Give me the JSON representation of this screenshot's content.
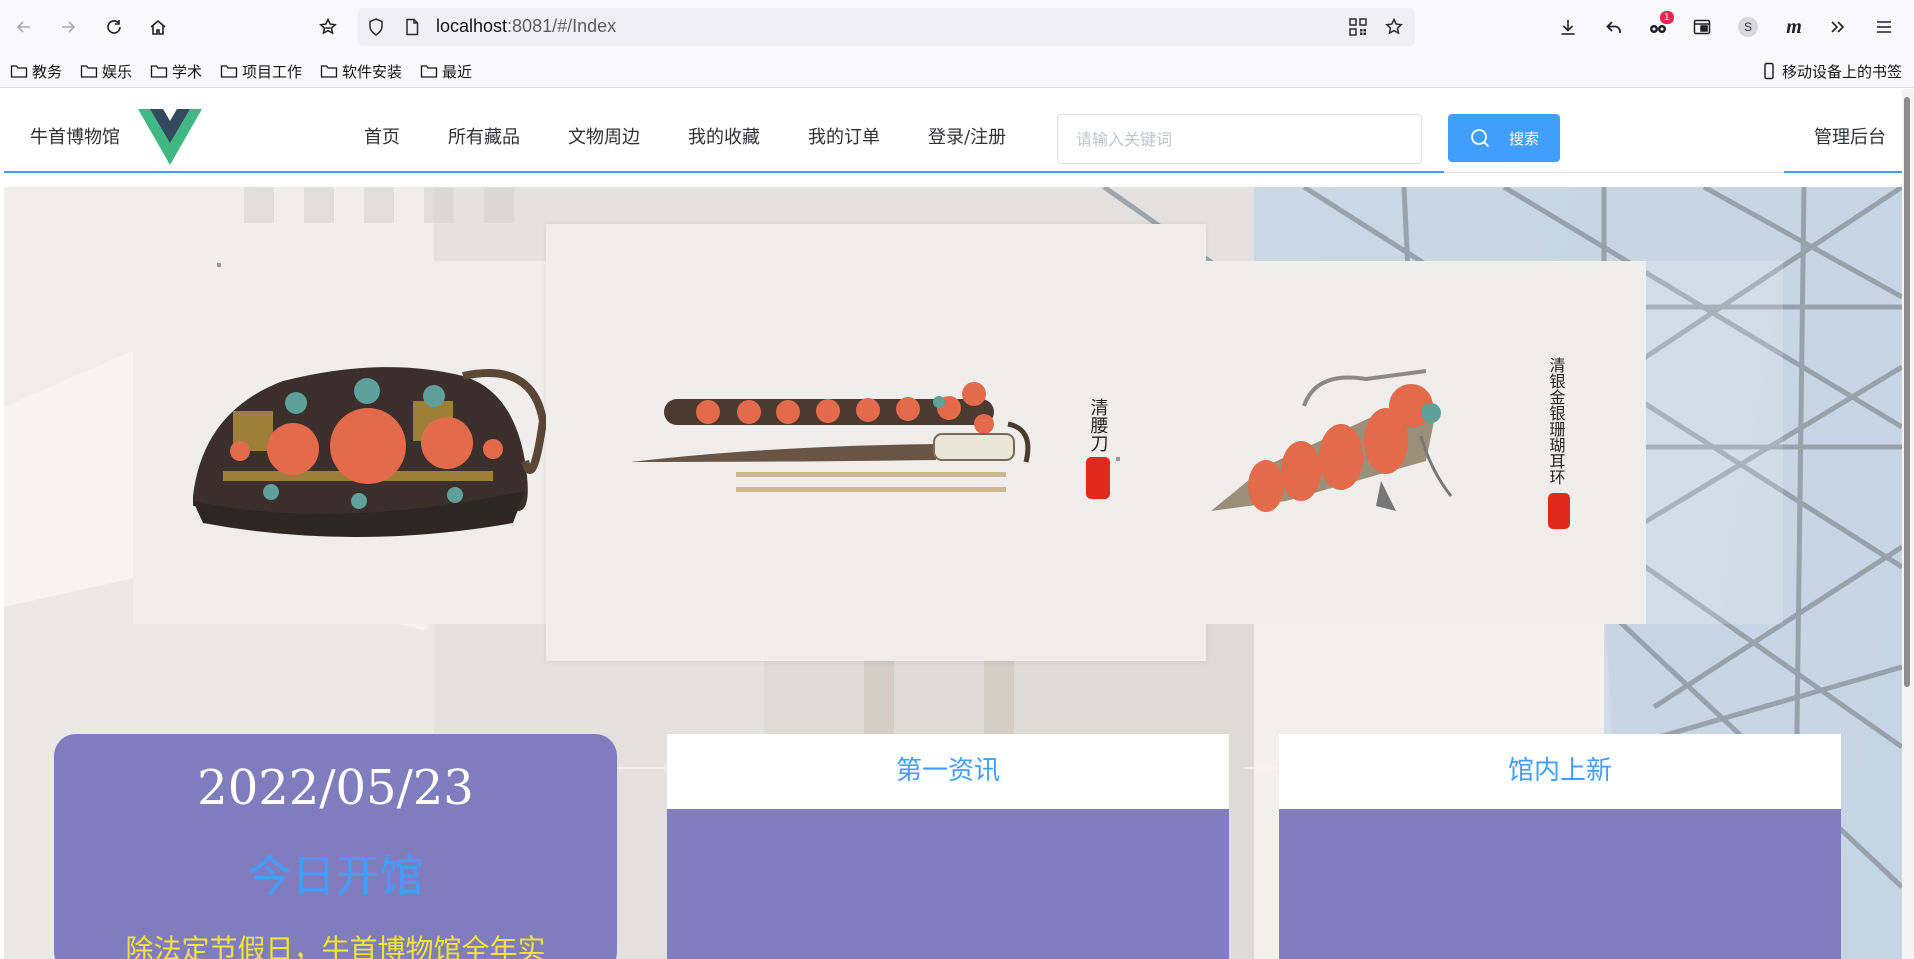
{
  "browser": {
    "url_host": "localhost",
    "url_rest": ":8081/#/Index",
    "extension_badge": "1",
    "profile_letter": "S",
    "m_ext": "m"
  },
  "bookmarks": {
    "items": [
      "教务",
      "娱乐",
      "学术",
      "项目工作",
      "软件安装",
      "最近"
    ],
    "mobile": "移动设备上的书签"
  },
  "nav": {
    "brand": "牛首博物馆",
    "menu": [
      "首页",
      "所有藏品",
      "文物周边",
      "我的收藏",
      "我的订单",
      "登录/注册"
    ],
    "search_placeholder": "请输入关键词",
    "search_button": "搜索",
    "admin": "管理后台"
  },
  "carousel": {
    "center_caption": "清腰刀",
    "right_caption": "清银金银珊瑚耳环"
  },
  "panels": {
    "date": "2022/05/23",
    "status": "今日开馆",
    "notice": "除法定节假日，牛首博物馆全年实",
    "news_title": "第一资讯",
    "new_arrivals_title": "馆内上新"
  },
  "colors": {
    "accent": "#409eff",
    "panel": "#7f7dbd",
    "notice": "#f6e33a"
  }
}
